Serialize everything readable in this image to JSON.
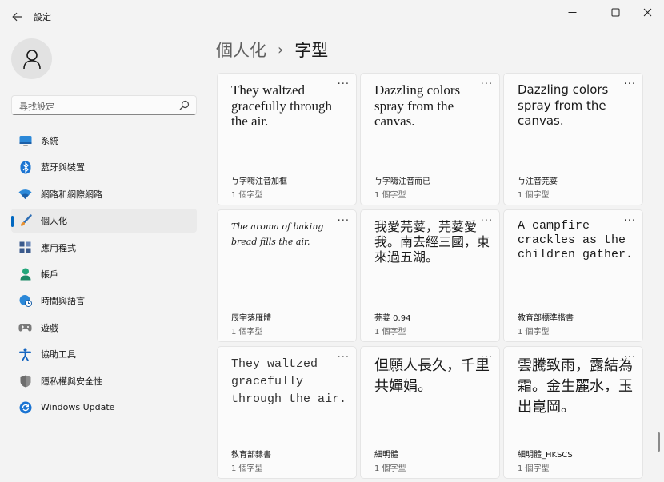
{
  "window": {
    "title": "設定",
    "back_icon": "back-arrow-icon",
    "minimize": "─",
    "maximize": "☐",
    "close": "✕"
  },
  "search": {
    "placeholder": "尋找設定",
    "icon": "search-icon"
  },
  "sidebar": {
    "items": [
      {
        "label": "系統",
        "icon": "monitor-icon",
        "color": "#0078d4",
        "active": false
      },
      {
        "label": "藍牙與裝置",
        "icon": "bluetooth-icon",
        "color": "#0078d4",
        "active": false
      },
      {
        "label": "網路和網際網路",
        "icon": "wifi-icon",
        "color": "#0078d4",
        "active": false
      },
      {
        "label": "個人化",
        "icon": "paintbrush-icon",
        "color": "#e08a2c",
        "active": true
      },
      {
        "label": "應用程式",
        "icon": "apps-icon",
        "color": "#3a5a8c",
        "active": false
      },
      {
        "label": "帳戶",
        "icon": "account-icon",
        "color": "#1fa37a",
        "active": false
      },
      {
        "label": "時間與語言",
        "icon": "globe-clock-icon",
        "color": "#0078d4",
        "active": false
      },
      {
        "label": "遊戲",
        "icon": "gamepad-icon",
        "color": "#707070",
        "active": false
      },
      {
        "label": "協助工具",
        "icon": "accessibility-icon",
        "color": "#1565c0",
        "active": false
      },
      {
        "label": "隱私權與安全性",
        "icon": "shield-icon",
        "color": "#6b6b6b",
        "active": false
      },
      {
        "label": "Windows Update",
        "icon": "update-icon",
        "color": "#0078d4",
        "active": false
      }
    ]
  },
  "breadcrumb": {
    "parent": "個人化",
    "separator": "›",
    "current": "字型"
  },
  "fonts": [
    {
      "preview": "They waltzed gracefully through the air.",
      "name": "ㄅ字嗨注音加框",
      "count": "1 個字型",
      "style": "f-lserif"
    },
    {
      "preview": "Dazzling colors spray from the canvas.",
      "name": "ㄅ字嗨注音而已",
      "count": "1 個字型",
      "style": "f-lserif"
    },
    {
      "preview": "Dazzling colors spray from the canvas.",
      "name": "ㄅ注音芫荽",
      "count": "1 個字型",
      "style": "f-sans"
    },
    {
      "preview": "The aroma of baking bread fills the air.",
      "name": "辰宇落雁體",
      "count": "1 個字型",
      "style": "f-script"
    },
    {
      "preview": "我愛芫荽，芫荽愛我。南去經三國，東來過五湖。",
      "name": "芫荽 0.94",
      "count": "1 個字型",
      "style": "f-cjk"
    },
    {
      "preview": "A campfire crackles as the children gather.",
      "name": "教育部標準楷書",
      "count": "1 個字型",
      "style": "f-mono"
    },
    {
      "preview": "They waltzed gracefully through the air.",
      "name": "教育部隸書",
      "count": "1 個字型",
      "style": "f-mono ellip"
    },
    {
      "preview": "但願人長久，千里共嬋娟。",
      "name": "細明體",
      "count": "1 個字型",
      "style": "f-cjk2"
    },
    {
      "preview": "雲騰致雨，露結為霜。金生麗水，玉出崑岡。",
      "name": "細明體_HKSCS",
      "count": "1 個字型",
      "style": "f-cjk2"
    }
  ],
  "card_more_label": "···"
}
